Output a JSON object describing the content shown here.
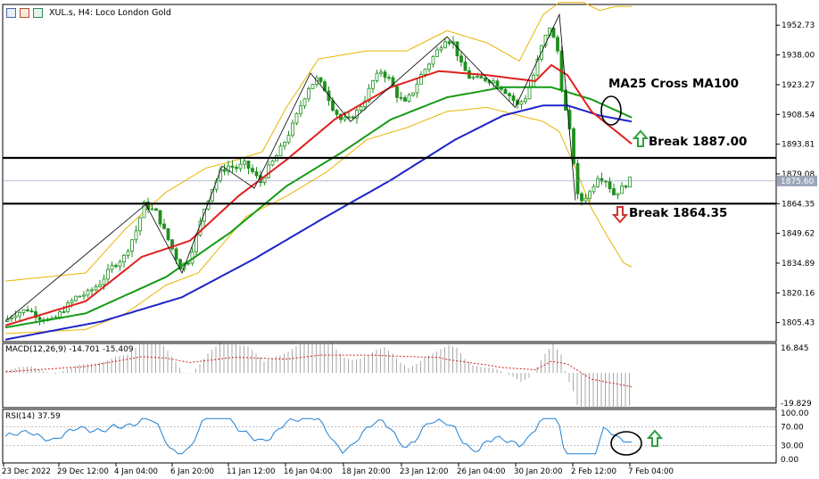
{
  "header": {
    "title": "XUL.s, H4:  Loco London Gold"
  },
  "colors": {
    "candle": "#1f8f1f",
    "ma_fast": "#e0201c",
    "ma_mid": "#159b15",
    "ma_slow": "#1e22c8",
    "bollinger": "#e8b400",
    "zigzag": "#000000",
    "level": "#000000",
    "current": "#8899bb",
    "rsi": "#1f7fd0",
    "macd_signal": "#cc2020",
    "macd_hist": "#a7a7a7",
    "up_arrow": "#2ea043",
    "down_arrow": "#d03030"
  },
  "annotations": {
    "ma_cross": "MA25 Cross MA100",
    "break_up": "Break 1887.00",
    "break_down": "Break 1864.35"
  },
  "chart_data": {
    "type": "candlestick",
    "symbol": "XUL.s",
    "timeframe": "H4",
    "instrument": "Loco London Gold",
    "x_labels": [
      "23 Dec 2022",
      "29 Dec 12:00",
      "4 Jan 04:00",
      "6 Jan 20:00",
      "11 Jan 12:00",
      "16 Jan 04:00",
      "18 Jan 20:00",
      "23 Jan 12:00",
      "26 Jan 04:00",
      "30 Jan 20:00",
      "2 Feb 12:00",
      "7 Feb 04:00"
    ],
    "price_ticks": [
      "1952.73",
      "1938.00",
      "1923.27",
      "1908.54",
      "1893.81",
      "1879.08",
      "1864.35",
      "1849.62",
      "1834.89",
      "1820.16",
      "1805.43"
    ],
    "ylim": [
      1796,
      1963
    ],
    "current_price": "1875.60",
    "levels": [
      1887.0,
      1864.35
    ],
    "close_path": [
      [
        0,
        1806
      ],
      [
        3,
        1810
      ],
      [
        6,
        1812
      ],
      [
        9,
        1808
      ],
      [
        12,
        1806
      ],
      [
        15,
        1812
      ],
      [
        18,
        1818
      ],
      [
        21,
        1820
      ],
      [
        24,
        1825
      ],
      [
        27,
        1833
      ],
      [
        30,
        1838
      ],
      [
        33,
        1851
      ],
      [
        35,
        1864
      ],
      [
        38,
        1860
      ],
      [
        40,
        1851
      ],
      [
        42,
        1842
      ],
      [
        44,
        1833
      ],
      [
        46,
        1836
      ],
      [
        48,
        1848
      ],
      [
        50,
        1862
      ],
      [
        52,
        1872
      ],
      [
        54,
        1880
      ],
      [
        56,
        1883
      ],
      [
        58,
        1882
      ],
      [
        60,
        1884
      ],
      [
        62,
        1880
      ],
      [
        64,
        1875
      ],
      [
        66,
        1882
      ],
      [
        68,
        1888
      ],
      [
        70,
        1895
      ],
      [
        72,
        1903
      ],
      [
        74,
        1913
      ],
      [
        76,
        1922
      ],
      [
        78,
        1926
      ],
      [
        80,
        1921
      ],
      [
        82,
        1912
      ],
      [
        84,
        1906
      ],
      [
        86,
        1906
      ],
      [
        88,
        1910
      ],
      [
        90,
        1916
      ],
      [
        92,
        1925
      ],
      [
        94,
        1930
      ],
      [
        96,
        1926
      ],
      [
        98,
        1918
      ],
      [
        100,
        1914
      ],
      [
        102,
        1920
      ],
      [
        104,
        1928
      ],
      [
        106,
        1934
      ],
      [
        108,
        1940
      ],
      [
        110,
        1946
      ],
      [
        112,
        1944
      ],
      [
        114,
        1933
      ],
      [
        116,
        1927
      ],
      [
        118,
        1926
      ],
      [
        120,
        1926
      ],
      [
        122,
        1925
      ],
      [
        124,
        1922
      ],
      [
        126,
        1918
      ],
      [
        128,
        1913
      ],
      [
        130,
        1917
      ],
      [
        132,
        1928
      ],
      [
        134,
        1942
      ],
      [
        136,
        1952
      ],
      [
        138,
        1940
      ],
      [
        139,
        1922
      ],
      [
        140,
        1910
      ],
      [
        141,
        1900
      ],
      [
        142,
        1885
      ],
      [
        143,
        1868
      ],
      [
        144,
        1866
      ],
      [
        146,
        1870
      ],
      [
        148,
        1878
      ],
      [
        150,
        1876
      ],
      [
        152,
        1869
      ],
      [
        154,
        1872
      ],
      [
        156,
        1876
      ]
    ],
    "bar_count": 156,
    "zigzag": [
      [
        0,
        1806
      ],
      [
        35,
        1864
      ],
      [
        44,
        1830
      ],
      [
        54,
        1883
      ],
      [
        62,
        1872
      ],
      [
        76,
        1929
      ],
      [
        86,
        1905
      ],
      [
        110,
        1947
      ],
      [
        127,
        1912
      ],
      [
        138,
        1958
      ],
      [
        142,
        1866
      ]
    ],
    "ma25": [
      [
        0,
        1804
      ],
      [
        20,
        1816
      ],
      [
        34,
        1838
      ],
      [
        46,
        1846
      ],
      [
        58,
        1868
      ],
      [
        70,
        1886
      ],
      [
        82,
        1906
      ],
      [
        96,
        1922
      ],
      [
        108,
        1930
      ],
      [
        120,
        1928
      ],
      [
        132,
        1925
      ],
      [
        136,
        1933
      ],
      [
        140,
        1928
      ],
      [
        146,
        1910
      ],
      [
        156,
        1894
      ]
    ],
    "ma50": [
      [
        0,
        1803
      ],
      [
        20,
        1810
      ],
      [
        40,
        1828
      ],
      [
        56,
        1850
      ],
      [
        70,
        1873
      ],
      [
        84,
        1890
      ],
      [
        96,
        1906
      ],
      [
        110,
        1917
      ],
      [
        124,
        1922
      ],
      [
        136,
        1922
      ],
      [
        146,
        1916
      ],
      [
        156,
        1907
      ]
    ],
    "ma100": [
      [
        0,
        1797
      ],
      [
        24,
        1806
      ],
      [
        44,
        1818
      ],
      [
        62,
        1837
      ],
      [
        80,
        1858
      ],
      [
        96,
        1876
      ],
      [
        112,
        1896
      ],
      [
        124,
        1908
      ],
      [
        134,
        1913
      ],
      [
        140,
        1913
      ],
      [
        148,
        1908
      ],
      [
        156,
        1905
      ]
    ],
    "bb_upper": [
      [
        0,
        1826
      ],
      [
        20,
        1830
      ],
      [
        30,
        1852
      ],
      [
        40,
        1870
      ],
      [
        50,
        1882
      ],
      [
        56,
        1885
      ],
      [
        64,
        1890
      ],
      [
        70,
        1912
      ],
      [
        78,
        1936
      ],
      [
        90,
        1940
      ],
      [
        100,
        1940
      ],
      [
        110,
        1950
      ],
      [
        120,
        1944
      ],
      [
        128,
        1935
      ],
      [
        134,
        1958
      ],
      [
        138,
        1964
      ],
      [
        144,
        1964
      ],
      [
        148,
        1960
      ],
      [
        152,
        1962
      ]
    ],
    "bb_lower": [
      [
        0,
        1800
      ],
      [
        20,
        1802
      ],
      [
        30,
        1810
      ],
      [
        40,
        1824
      ],
      [
        48,
        1830
      ],
      [
        60,
        1858
      ],
      [
        70,
        1868
      ],
      [
        80,
        1880
      ],
      [
        90,
        1896
      ],
      [
        100,
        1902
      ],
      [
        110,
        1910
      ],
      [
        120,
        1912
      ],
      [
        128,
        1908
      ],
      [
        134,
        1905
      ],
      [
        138,
        1900
      ],
      [
        142,
        1882
      ],
      [
        146,
        1862
      ],
      [
        150,
        1848
      ],
      [
        154,
        1835
      ],
      [
        156,
        1833
      ]
    ],
    "macd": {
      "label": "MACD(12,26,9) -14.701 -15.409",
      "params": [
        12,
        26,
        9
      ],
      "main": -14.701,
      "signal": -15.409,
      "ylim": [
        -19.829,
        16.845
      ],
      "ticks": [
        "16.845",
        "-19.829"
      ]
    },
    "rsi": {
      "label": "RSI(14) 37.59",
      "period": 14,
      "value": 37.59,
      "ylim": [
        0,
        100
      ],
      "levels": [
        30,
        70
      ],
      "ticks": [
        "100.00",
        "70.00",
        "30.00",
        "0.00"
      ]
    }
  }
}
